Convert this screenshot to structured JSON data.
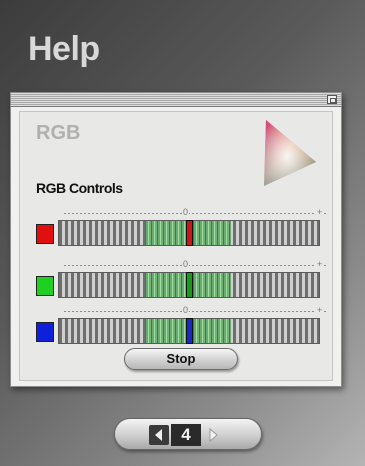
{
  "page": {
    "title": "Help"
  },
  "panel": {
    "heading": "RGB",
    "controls_label": "RGB Controls",
    "sliders": [
      {
        "channel": "red",
        "swatch_color": "#e01010",
        "thumb_color": "#c81818",
        "scale_mid": "0",
        "scale_plus": "+",
        "level": 0.5
      },
      {
        "channel": "green",
        "swatch_color": "#20d020",
        "thumb_color": "#1a9a1a",
        "scale_mid": "0",
        "scale_plus": "+",
        "level": 0.5
      },
      {
        "channel": "blue",
        "swatch_color": "#1020d8",
        "thumb_color": "#1a2ac0",
        "scale_mid": "0",
        "scale_plus": "+",
        "level": 0.5
      }
    ],
    "stop_label": "Stop",
    "triangle_icon": "color-gamut-triangle-icon"
  },
  "pager": {
    "current_page": "4",
    "prev_icon": "chevron-left-icon",
    "next_icon": "chevron-right-icon"
  }
}
